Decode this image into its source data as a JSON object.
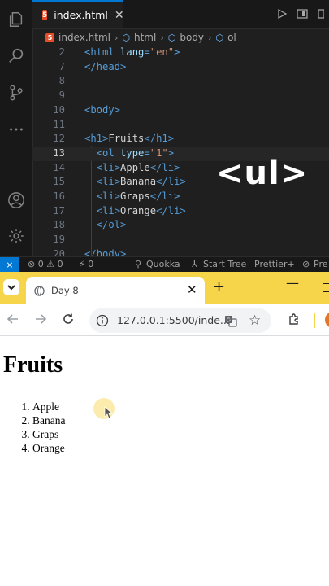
{
  "editor": {
    "tab": {
      "filename": "index.html",
      "badge": "5"
    },
    "breadcrumb": {
      "file": "index.html",
      "items": [
        "html",
        "body",
        "ol"
      ]
    },
    "lines": [
      {
        "num": "2",
        "tokens": [
          [
            "tag",
            "<html "
          ],
          [
            "attr",
            "lang"
          ],
          [
            "tag",
            "="
          ],
          [
            "str",
            "\"en\""
          ],
          [
            "tag",
            ">"
          ]
        ]
      },
      {
        "num": "7",
        "tokens": [
          [
            "tag",
            "</head>"
          ]
        ]
      },
      {
        "num": "8",
        "tokens": []
      },
      {
        "num": "9",
        "tokens": []
      },
      {
        "num": "10",
        "tokens": [
          [
            "tag",
            "<body>"
          ]
        ]
      },
      {
        "num": "11",
        "tokens": []
      },
      {
        "num": "12",
        "tokens": [
          [
            "tag",
            "<h1>"
          ],
          [
            "txt",
            "Fruits"
          ],
          [
            "tag",
            "</h1>"
          ]
        ]
      },
      {
        "num": "13",
        "active": true,
        "tokens": [
          [
            "txt",
            "  "
          ],
          [
            "tag",
            "<ol "
          ],
          [
            "attr",
            "type"
          ],
          [
            "tag",
            "="
          ],
          [
            "str",
            "\"1\""
          ],
          [
            "tag",
            ">"
          ]
        ]
      },
      {
        "num": "14",
        "tokens": [
          [
            "txt",
            "  "
          ],
          [
            "tag",
            "<li>"
          ],
          [
            "txt",
            "Apple"
          ],
          [
            "tag",
            "</li>"
          ]
        ]
      },
      {
        "num": "15",
        "tokens": [
          [
            "txt",
            "  "
          ],
          [
            "tag",
            "<li>"
          ],
          [
            "txt",
            "Banana"
          ],
          [
            "tag",
            "</li>"
          ]
        ]
      },
      {
        "num": "16",
        "tokens": [
          [
            "txt",
            "  "
          ],
          [
            "tag",
            "<li>"
          ],
          [
            "txt",
            "Graps"
          ],
          [
            "tag",
            "</li>"
          ]
        ]
      },
      {
        "num": "17",
        "tokens": [
          [
            "txt",
            "  "
          ],
          [
            "tag",
            "<li>"
          ],
          [
            "txt",
            "Orange"
          ],
          [
            "tag",
            "</li>"
          ]
        ]
      },
      {
        "num": "18",
        "tokens": [
          [
            "txt",
            "  "
          ],
          [
            "tag",
            "</ol>"
          ]
        ]
      },
      {
        "num": "19",
        "tokens": []
      },
      {
        "num": "20",
        "tokens": [
          [
            "tag",
            "</body>"
          ]
        ]
      }
    ],
    "overlay_text": "<ul>",
    "status": {
      "remote": "⨯",
      "problems": "⊗ 0 ⚠ 0",
      "ports": "⚡ 0",
      "quokka": "Quokka",
      "start_tree": "Start Tree",
      "prettier": "Prettier+",
      "extra": "Pre"
    }
  },
  "browser": {
    "tab_title": "Day 8",
    "url": "127.0.0.1:5500/inde...",
    "page": {
      "heading": "Fruits",
      "list": [
        "Apple",
        "Banana",
        "Graps",
        "Orange"
      ]
    }
  },
  "colors": {
    "chrome_accent": "#f7d54a",
    "vscode_accent": "#0078d4",
    "html_tag": "#569cd6",
    "html_attr": "#9cdcfe",
    "html_string": "#ce9178"
  }
}
